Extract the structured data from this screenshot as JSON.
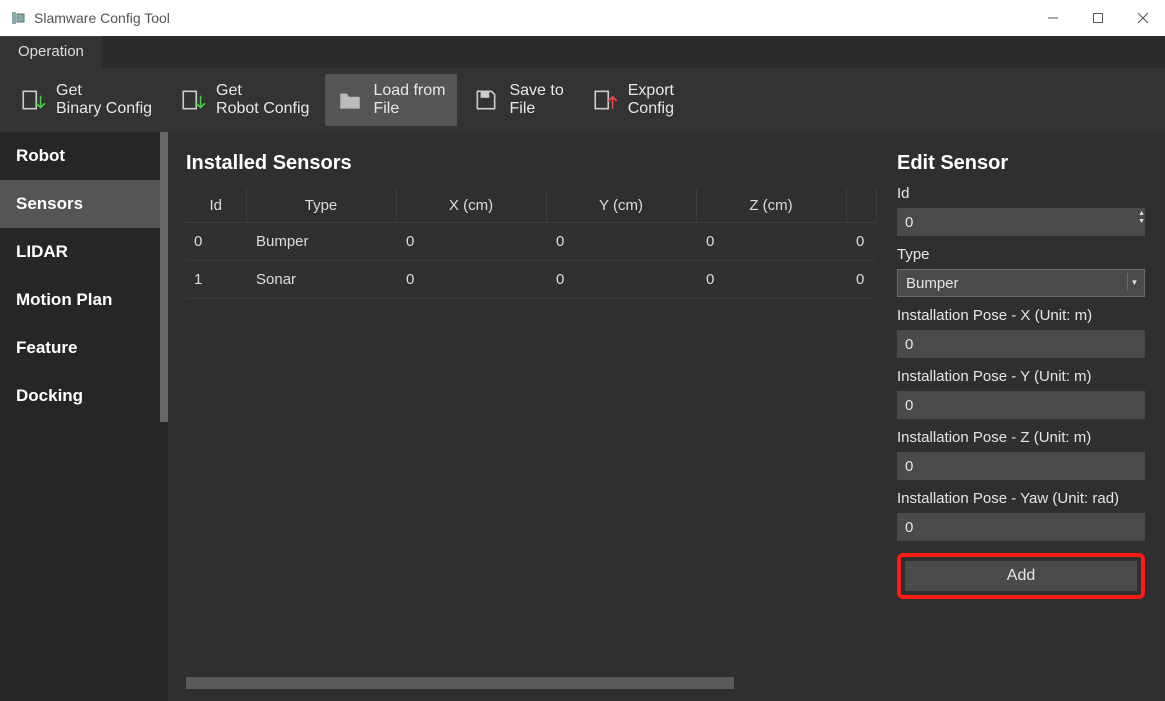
{
  "window": {
    "title": "Slamware Config Tool"
  },
  "menubar": {
    "operation": "Operation"
  },
  "ribbon": {
    "getBinary": {
      "line1": "Get",
      "line2": "Binary Config"
    },
    "getRobot": {
      "line1": "Get",
      "line2": "Robot Config"
    },
    "loadFile": {
      "line1": "Load from",
      "line2": "File"
    },
    "saveFile": {
      "line1": "Save to",
      "line2": "File"
    },
    "exportCfg": {
      "line1": "Export",
      "line2": "Config"
    }
  },
  "sidebar": {
    "items": [
      "Robot",
      "Sensors",
      "LIDAR",
      "Motion Plan",
      "Feature",
      "Docking"
    ]
  },
  "table": {
    "title": "Installed Sensors",
    "headers": {
      "id": "Id",
      "type": "Type",
      "x": "X (cm)",
      "y": "Y (cm)",
      "z": "Z (cm)"
    },
    "rows": [
      {
        "id": "0",
        "type": "Bumper",
        "x": "0",
        "y": "0",
        "z": "0",
        "extra": "0"
      },
      {
        "id": "1",
        "type": "Sonar",
        "x": "0",
        "y": "0",
        "z": "0",
        "extra": "0"
      }
    ]
  },
  "edit": {
    "title": "Edit Sensor",
    "labels": {
      "id": "Id",
      "type": "Type",
      "x": "Installation Pose - X (Unit: m)",
      "y": "Installation Pose - Y (Unit: m)",
      "z": "Installation Pose - Z (Unit: m)",
      "yaw": "Installation Pose - Yaw (Unit: rad)"
    },
    "values": {
      "id": "0",
      "type": "Bumper",
      "x": "0",
      "y": "0",
      "z": "0",
      "yaw": "0"
    },
    "addButton": "Add"
  }
}
